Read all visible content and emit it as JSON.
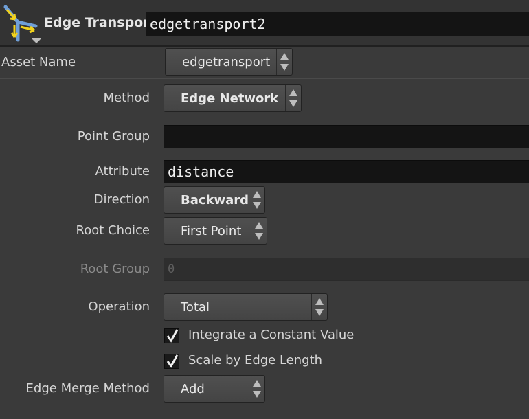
{
  "header": {
    "node_type_label": "Edge Transport",
    "node_name": "edgetransport2",
    "icon": "edge-transport-node-icon"
  },
  "asset": {
    "label": "Asset Name",
    "value": "edgetransport"
  },
  "params": {
    "method": {
      "label": "Method",
      "value": "Edge Network"
    },
    "point_group": {
      "label": "Point Group",
      "value": ""
    },
    "attribute": {
      "label": "Attribute",
      "value": "distance"
    },
    "direction": {
      "label": "Direction",
      "value": "Backward"
    },
    "root_choice": {
      "label": "Root Choice",
      "value": "First Point"
    },
    "root_group": {
      "label": "Root Group",
      "value": "0"
    },
    "operation": {
      "label": "Operation",
      "value": "Total"
    },
    "integrate_constant": {
      "label": "Integrate a Constant Value",
      "checked": true
    },
    "scale_by_edge": {
      "label": "Scale by Edge Length",
      "checked": true
    },
    "edge_merge": {
      "label": "Edge Merge Method",
      "value": "Add"
    }
  },
  "colors": {
    "background": "#3a3a3a",
    "field": "#141414",
    "icon_yellow": "#f2d21c",
    "icon_blue": "#6f9fd8"
  }
}
